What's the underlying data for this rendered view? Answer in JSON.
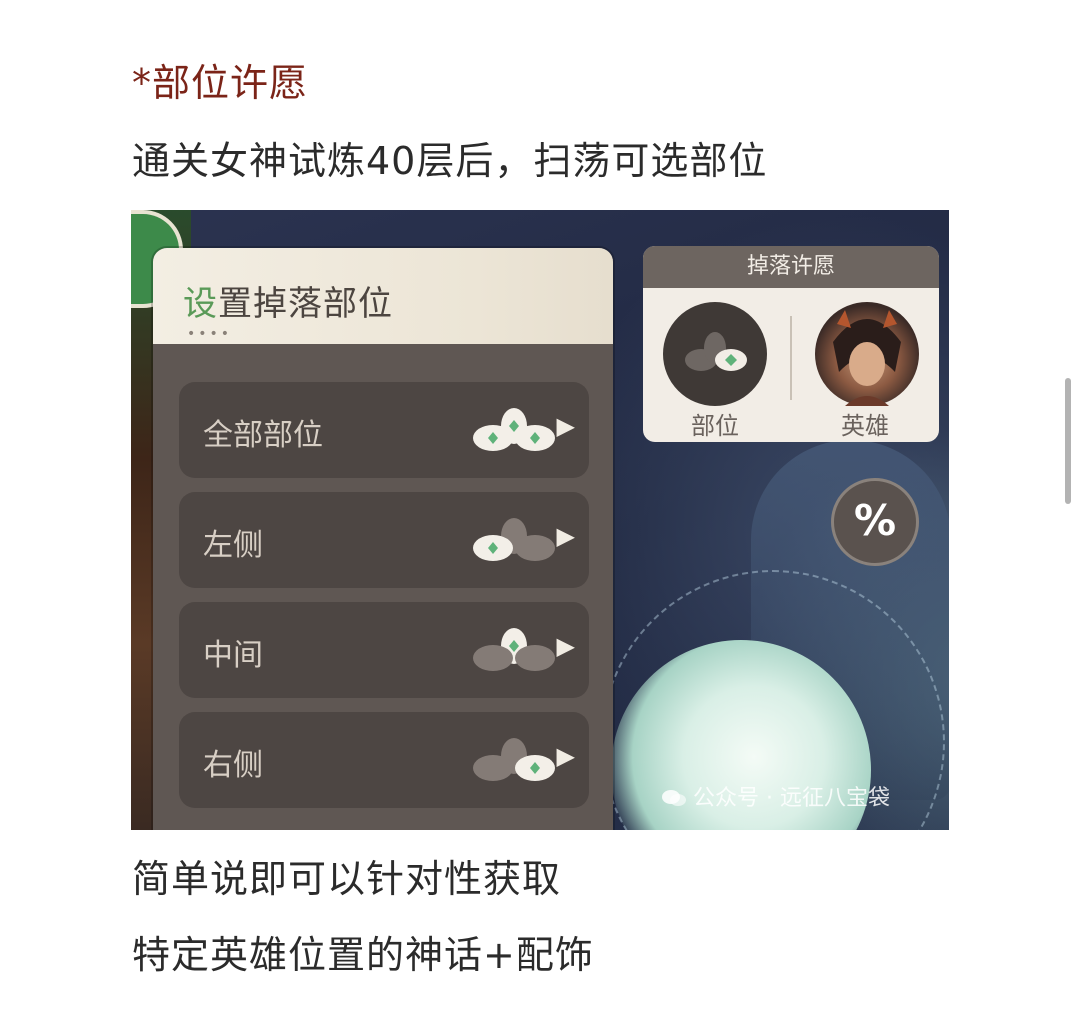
{
  "article": {
    "heading": "*部位许愿",
    "para1": "通关女神试炼40层后，扫荡可选部位",
    "para2": "简单说即可以针对性获取",
    "para3": "特定英雄位置的神话+配饰"
  },
  "game": {
    "panel": {
      "title_first": "设",
      "title_rest": "置掉落部位",
      "dots": "••••",
      "rows": [
        {
          "label": "全部部位",
          "highlight": "all"
        },
        {
          "label": "左侧",
          "highlight": "left"
        },
        {
          "label": "中间",
          "highlight": "middle"
        },
        {
          "label": "右侧",
          "highlight": "right"
        }
      ]
    },
    "wish": {
      "title": "掉落许愿",
      "part_label": "部位",
      "hero_label": "英雄"
    },
    "percent_symbol": "%",
    "watermark": "公众号 · 远征八宝袋",
    "colors": {
      "heading": "#7b2418",
      "accent_green": "#5a9a58",
      "panel": "#5f5753",
      "row": "#4d4643"
    }
  }
}
